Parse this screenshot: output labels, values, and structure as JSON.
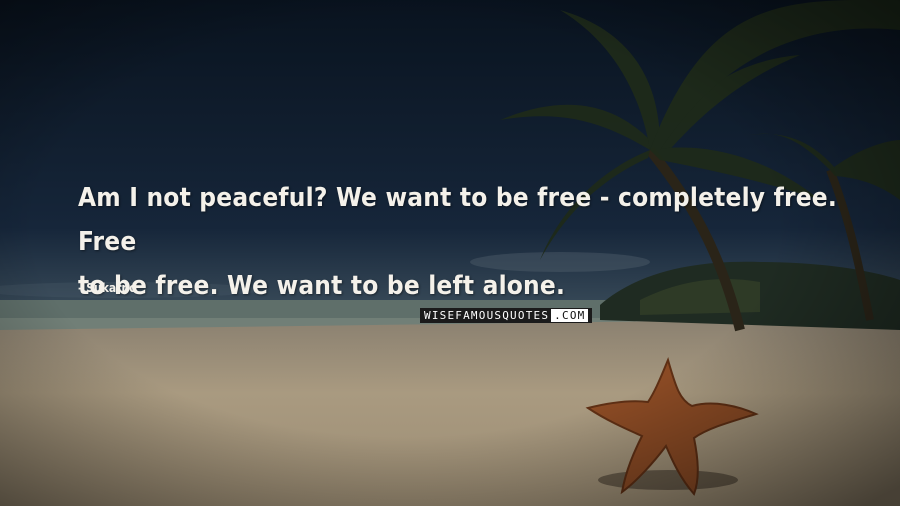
{
  "quote": {
    "line1": "Am I not peaceful? We want to be free - completely free. Free",
    "line2": "to be free. We want to be left alone.",
    "author": "- Sukarno"
  },
  "watermark": {
    "main": "WISEFAMOUSQUOTES",
    "suffix": ".COM"
  },
  "scene": {
    "description_icons": [
      "palm-tree-icon",
      "starfish-icon"
    ],
    "colors": {
      "sky_top": "#0b1626",
      "sky_bottom": "#2a3d4f",
      "sea": "#6d7c74",
      "sand": "#b8a68a",
      "text": "#f4f1ea"
    }
  }
}
